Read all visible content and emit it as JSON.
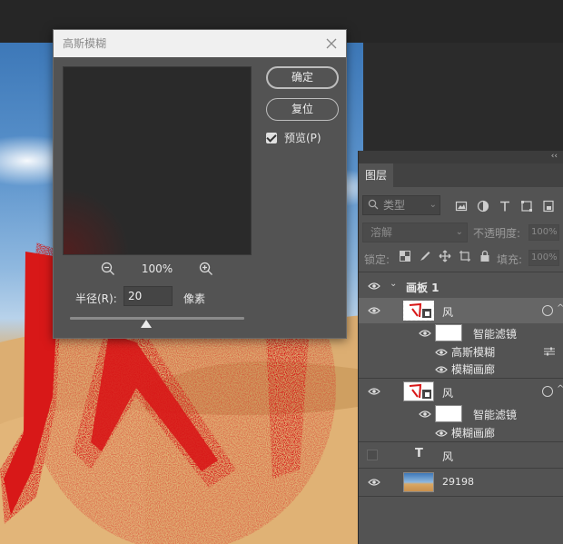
{
  "dialog": {
    "title": "高斯模糊",
    "ok_label": "确定",
    "reset_label": "复位",
    "preview_label": "预览(P)",
    "preview_checked": true,
    "zoom": "100%",
    "radius_label": "半径(R):",
    "radius_value": "20",
    "radius_unit": "像素"
  },
  "layers_panel": {
    "tab": "图层",
    "filter_placeholder": "类型",
    "blend_mode": "溶解",
    "opacity_label": "不透明度:",
    "opacity_value": "100%",
    "lock_label": "锁定:",
    "fill_label": "填充:",
    "fill_value": "100%",
    "artboard_name": "画板 1",
    "layers": [
      {
        "name": "风",
        "type": "smart-object",
        "visible": true,
        "selected": true
      },
      {
        "name": "智能滤镜",
        "type": "smart-filters",
        "visible": true
      },
      {
        "name": "高斯模糊",
        "type": "filter",
        "visible": true
      },
      {
        "name": "模糊画廊",
        "type": "filter",
        "visible": true
      },
      {
        "name": "风",
        "type": "smart-object",
        "visible": true
      },
      {
        "name": "智能滤镜",
        "type": "smart-filters",
        "visible": true
      },
      {
        "name": "模糊画廊",
        "type": "filter",
        "visible": true
      },
      {
        "name": "风",
        "type": "text",
        "visible": false
      },
      {
        "name": "29198",
        "type": "image",
        "visible": true
      }
    ]
  },
  "colors": {
    "panel_bg": "#535353",
    "selected_row": "#666666",
    "artwork_red": "#d81818"
  }
}
